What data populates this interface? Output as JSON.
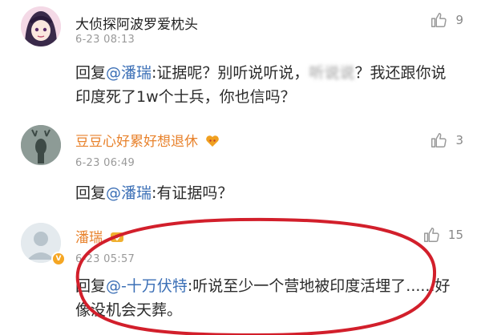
{
  "comments": [
    {
      "name": "大侦探阿波罗爱枕头",
      "time": "6-23 08:13",
      "likes": "9",
      "reply_prefix": "回复",
      "mention": "@潘瑞",
      "text": ":证据呢？别听说听说，",
      "blurred": "听说说",
      "text2": "？我还跟你说印度死了1w个士兵，你也信吗？"
    },
    {
      "name": "豆豆心好累好想退休",
      "time": "6-23 06:49",
      "likes": "3",
      "reply_prefix": "回复",
      "mention": "@潘瑞",
      "text": ":有证据吗？"
    },
    {
      "name": "潘瑞",
      "time": "6-23 05:57",
      "likes": "15",
      "reply_prefix": "回复",
      "mention": "@-十万伏特",
      "text": ":听说至少一个营地被印度活埋了......好像没机会天葬。"
    }
  ],
  "colors": {
    "name_orange": "#e8822c",
    "mention_blue": "#3b6fb6",
    "highlight_red": "#d21f2b"
  }
}
